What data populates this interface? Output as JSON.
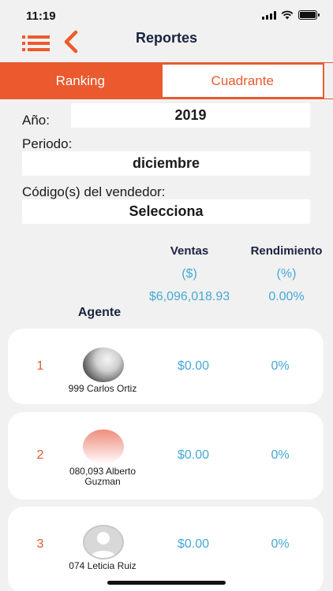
{
  "status": {
    "time": "11:19"
  },
  "nav": {
    "title": "Reportes",
    "menu_icon": "menu-list-icon",
    "back_icon": "chevron-left-icon"
  },
  "tabs": [
    {
      "label": "Ranking",
      "active": true
    },
    {
      "label": "Cuadrante",
      "active": false
    }
  ],
  "filters": {
    "year": {
      "label": "Año:",
      "value": "2019"
    },
    "period": {
      "label": "Periodo:",
      "value": "diciembre"
    },
    "seller": {
      "label": "Código(s) del vendedor:",
      "value": "Selecciona"
    }
  },
  "table": {
    "agent_header": "Agente",
    "ventas_header": "Ventas",
    "ventas_unit": "($)",
    "ventas_total": "$6,096,018.93",
    "rend_header": "Rendimiento",
    "rend_unit": "(%)",
    "rend_total": "0.00%"
  },
  "agents": [
    {
      "rank": "1",
      "name": "999 Carlos Ortiz",
      "ventas": "$0.00",
      "rendimiento": "0%"
    },
    {
      "rank": "2",
      "name": "080,093 Alberto Guzman",
      "ventas": "$0.00",
      "rendimiento": "0%"
    },
    {
      "rank": "3",
      "name": "074 Leticia Ruiz",
      "ventas": "$0.00",
      "rendimiento": "0%"
    }
  ],
  "colors": {
    "accent": "#ea5a2e",
    "value_blue": "#46a8d6",
    "title_navy": "#1a2340"
  }
}
